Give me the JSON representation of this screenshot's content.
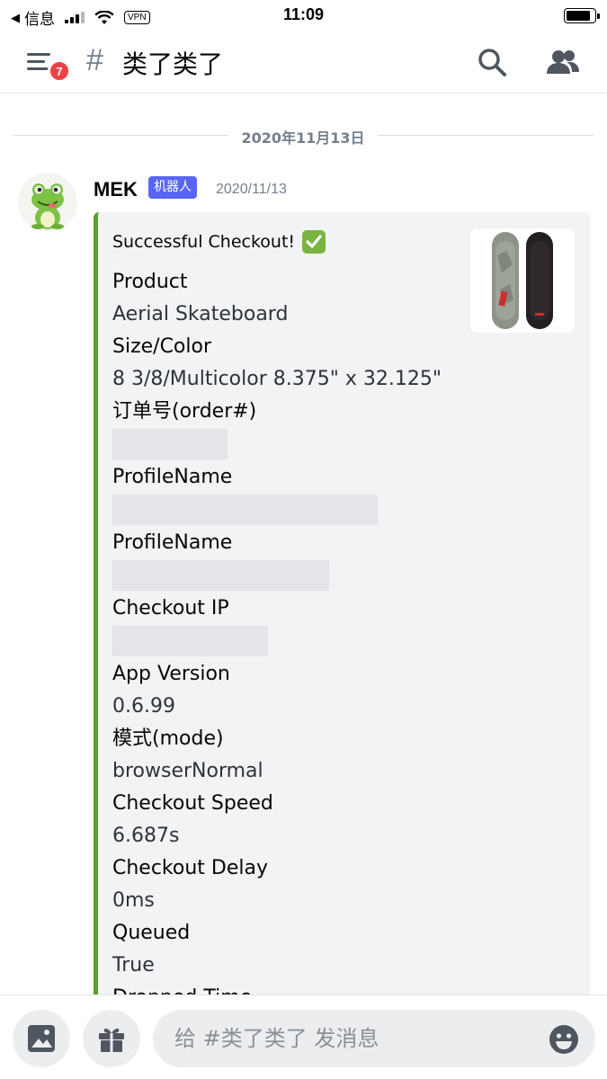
{
  "status_bar": {
    "back_app": "信息",
    "time": "11:09",
    "vpn": "VPN"
  },
  "header": {
    "unread_badge": "7",
    "hash": "#",
    "channel_name": "类了类了"
  },
  "chat": {
    "date_divider": "2020年11月13日",
    "message": {
      "author": "MEK",
      "bot_tag": "机器人",
      "timestamp": "2020/11/13",
      "embed": {
        "accent_color": "#5aa02c",
        "title": "Successful Checkout!",
        "fields": [
          {
            "name": "Product",
            "value": "Aerial Skateboard"
          },
          {
            "name": "Size/Color",
            "value": "8 3/8/Multicolor 8.375\" x 32.125\""
          },
          {
            "name": "订单号(order#)",
            "value": ""
          },
          {
            "name": "ProfileName",
            "value": ""
          },
          {
            "name": "ProfileName",
            "value": ""
          },
          {
            "name": "Checkout IP",
            "value": ""
          },
          {
            "name": "App Version",
            "value": "0.6.99"
          },
          {
            "name": "模式(mode)",
            "value": "browserNormal"
          },
          {
            "name": "Checkout Speed",
            "value": "6.687s"
          },
          {
            "name": "Checkout Delay",
            "value": "0ms"
          },
          {
            "name": "Queued",
            "value": "True"
          },
          {
            "name": "Dropped Time",
            "value": ""
          }
        ]
      }
    }
  },
  "input_bar": {
    "placeholder": "给 #类了类了 发消息"
  }
}
